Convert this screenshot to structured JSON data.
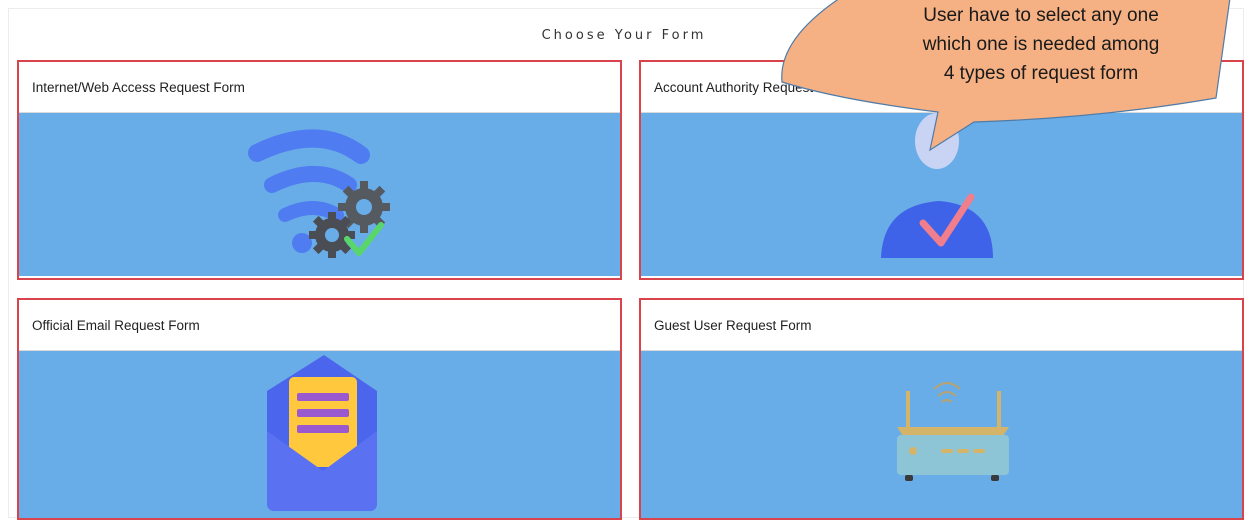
{
  "page": {
    "title": "Choose Your Form"
  },
  "forms": [
    {
      "label": "Internet/Web Access Request Form",
      "icon": "wifi-gear-icon"
    },
    {
      "label": "Account Authority Request Form",
      "icon": "user-check-icon"
    },
    {
      "label": "Official Email Request Form",
      "icon": "envelope-icon"
    },
    {
      "label": "Guest User Request Form",
      "icon": "router-icon"
    }
  ],
  "callout": {
    "line1": "User have to select any one",
    "line2": "which one is needed among",
    "line3": "4 types of request form"
  },
  "colors": {
    "card_border": "#d9434b",
    "card_body": "#69ade8",
    "callout_fill": "#f5b183"
  }
}
